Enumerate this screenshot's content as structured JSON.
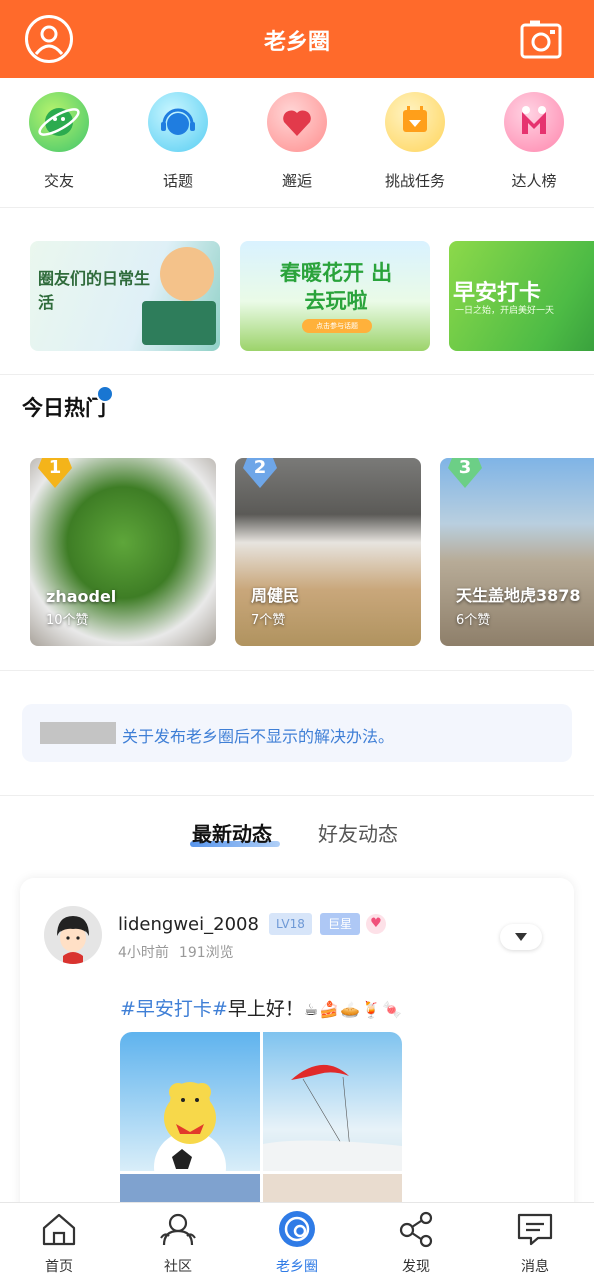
{
  "header": {
    "title": "老乡圈"
  },
  "categories": [
    {
      "label": "交友",
      "icon": "planet-icon"
    },
    {
      "label": "话题",
      "icon": "headset-icon"
    },
    {
      "label": "邂逅",
      "icon": "heart-hands-icon"
    },
    {
      "label": "挑战任务",
      "icon": "calendar-task-icon"
    },
    {
      "label": "达人榜",
      "icon": "medal-m-icon"
    }
  ],
  "banners": [
    {
      "text": "圈友们的日常生活"
    },
    {
      "text": "春暖花开 出去玩啦",
      "sub": "点击参与话题"
    },
    {
      "text": "早安打卡",
      "sub": "一日之始，开启美好一天"
    }
  ],
  "hot": {
    "title": "今日热门",
    "items": [
      {
        "rank": "1",
        "name": "zhaodel",
        "likes": "10个赞"
      },
      {
        "rank": "2",
        "name": "周健民",
        "likes": "7个赞"
      },
      {
        "rank": "3",
        "name": "天生盖地虎3878",
        "likes": "6个赞"
      }
    ]
  },
  "notice": {
    "text": "关于发布老乡圈后不显示的解决办法。"
  },
  "tabs": {
    "latest": "最新动态",
    "friends": "好友动态"
  },
  "post": {
    "username": "lidengwei_2008",
    "level": "LV18",
    "badge": "巨星",
    "time": "4小时前",
    "views": "191浏览",
    "tag": "#早安打卡#",
    "text": "早上好！",
    "emojis": "☕🍰🥧🍹🍬"
  },
  "nav": [
    {
      "label": "首页",
      "icon": "home-icon"
    },
    {
      "label": "社区",
      "icon": "community-icon"
    },
    {
      "label": "老乡圈",
      "icon": "circle-icon"
    },
    {
      "label": "发现",
      "icon": "share-icon"
    },
    {
      "label": "消息",
      "icon": "message-icon"
    }
  ],
  "colors": {
    "brand": "#ff6a2b",
    "accent": "#2f7be6",
    "link": "#3f7fd6"
  }
}
